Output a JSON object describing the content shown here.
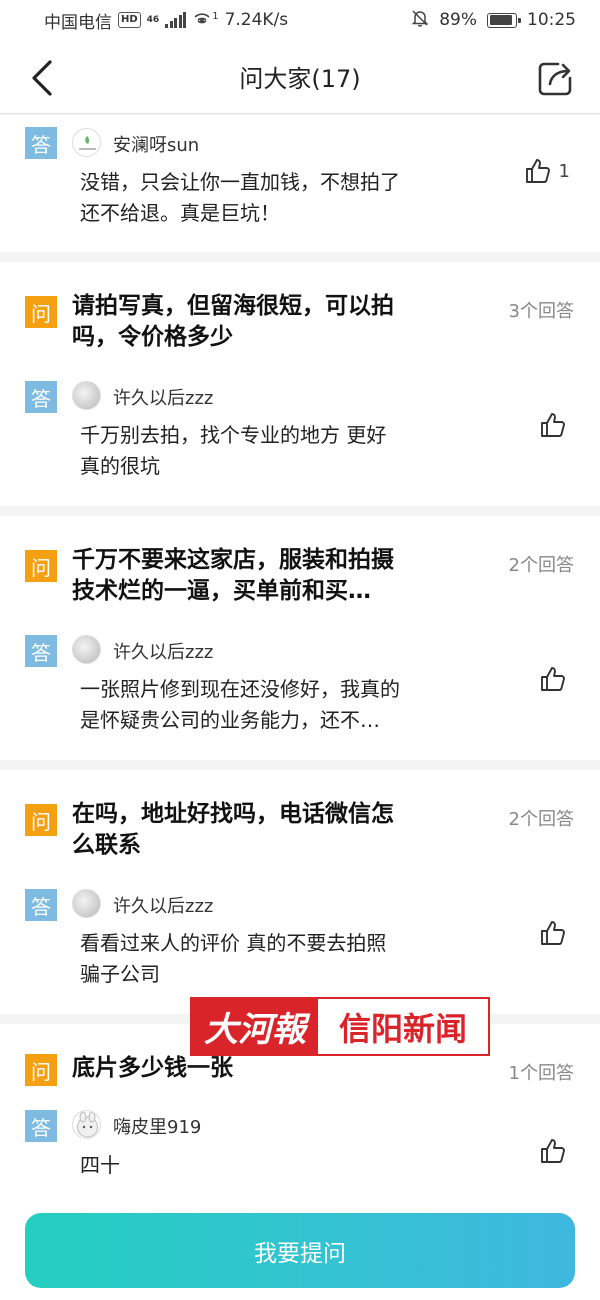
{
  "status_bar": {
    "carrier": "中国电信",
    "hd": "HD",
    "network": "46",
    "hotspot_sup": "1",
    "speed": "7.24K/s",
    "battery": "89%",
    "battery_level": 0.89,
    "time": "10:25"
  },
  "header": {
    "title": "问大家(17)",
    "back_icon": "chevron-left-icon",
    "share_icon": "share-icon"
  },
  "labels": {
    "question": "问",
    "answer": "答"
  },
  "colors": {
    "question_tag": "#f5a011",
    "answer_tag": "#7fbbe0",
    "button_start": "#24cfc0",
    "button_end": "#3fb8df"
  },
  "top_answer": {
    "username": "安澜呀sun",
    "text_line1": "没错，只会让你一直加钱，不想拍了",
    "text_line2": "还不给退。真是巨坑！",
    "likes": "1"
  },
  "questions": [
    {
      "title_line1": "请拍写真，但留海很短，可以拍",
      "title_line2": "吗，令价格多少",
      "answer_count": "3个回答",
      "username": "许久以后zzz",
      "answer_line1": "千万别去拍，找个专业的地方 更好",
      "answer_line2": "真的很坑"
    },
    {
      "title_line1": "千万不要来这家店，服装和拍摄",
      "title_line2": "技术烂的一逼，买单前和买…",
      "answer_count": "2个回答",
      "username": "许久以后zzz",
      "answer_line1": "一张照片修到现在还没修好，我真的",
      "answer_line2": "是怀疑贵公司的业务能力，还不…"
    },
    {
      "title_line1": "在吗，地址好找吗，电话微信怎",
      "title_line2": "么联系",
      "answer_count": "2个回答",
      "username": "许久以后zzz",
      "answer_line1": "看看过来人的评价 真的不要去拍照",
      "answer_line2": "骗子公司"
    },
    {
      "title_line1": "底片多少钱一张",
      "answer_count": "1个回答",
      "username": "嗨皮里919",
      "answer_line1": "四十"
    }
  ],
  "watermark": {
    "left": "大河報",
    "right": "信阳新闻"
  },
  "bottom": {
    "ask_button": "我要提问"
  }
}
